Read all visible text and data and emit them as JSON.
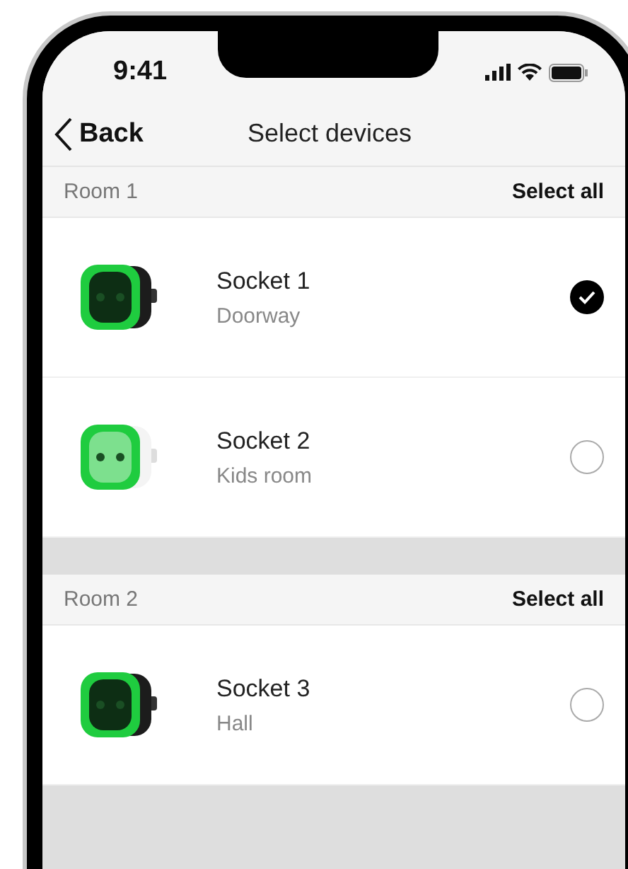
{
  "status_bar": {
    "time": "9:41"
  },
  "nav": {
    "back": "Back",
    "title": "Select devices"
  },
  "rooms": [
    {
      "name": "Room 1",
      "action": "Select all",
      "devices": [
        {
          "name": "Socket 1",
          "location": "Doorway",
          "color": "#1c1c1c",
          "selected": true
        },
        {
          "name": "Socket 2",
          "location": "Kids room",
          "color": "#f4f4f4",
          "selected": false
        }
      ]
    },
    {
      "name": "Room 2",
      "action": "Select all",
      "devices": [
        {
          "name": "Socket 3",
          "location": "Hall",
          "color": "#1c1c1c",
          "selected": false
        }
      ]
    }
  ]
}
